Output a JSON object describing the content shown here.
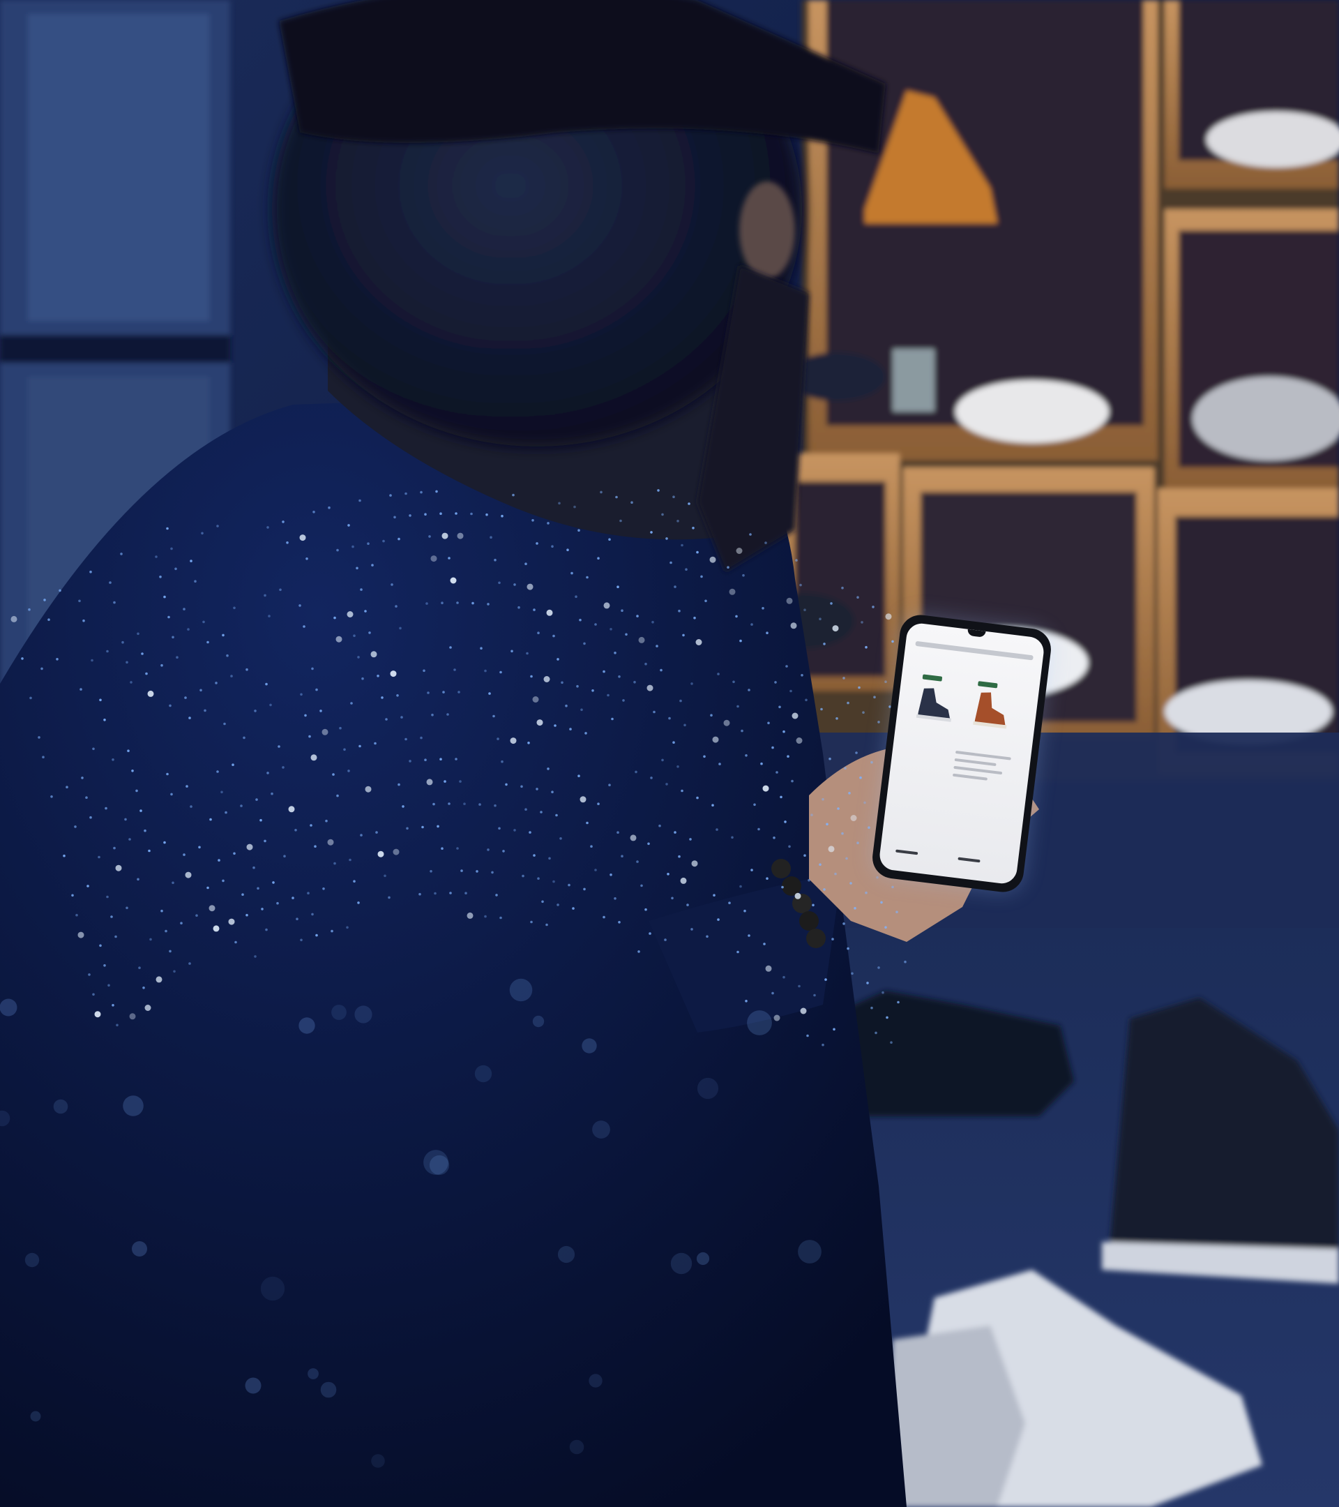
{
  "scene": {
    "subject": "person-with-smartphone",
    "setting": "shoe-store-shelves",
    "colors": {
      "shadow": "#050d26",
      "jacket": "#0b1a4a",
      "glow": "#7fb3ff",
      "wood": "#c48a52",
      "wall": "#1a2a55"
    }
  }
}
